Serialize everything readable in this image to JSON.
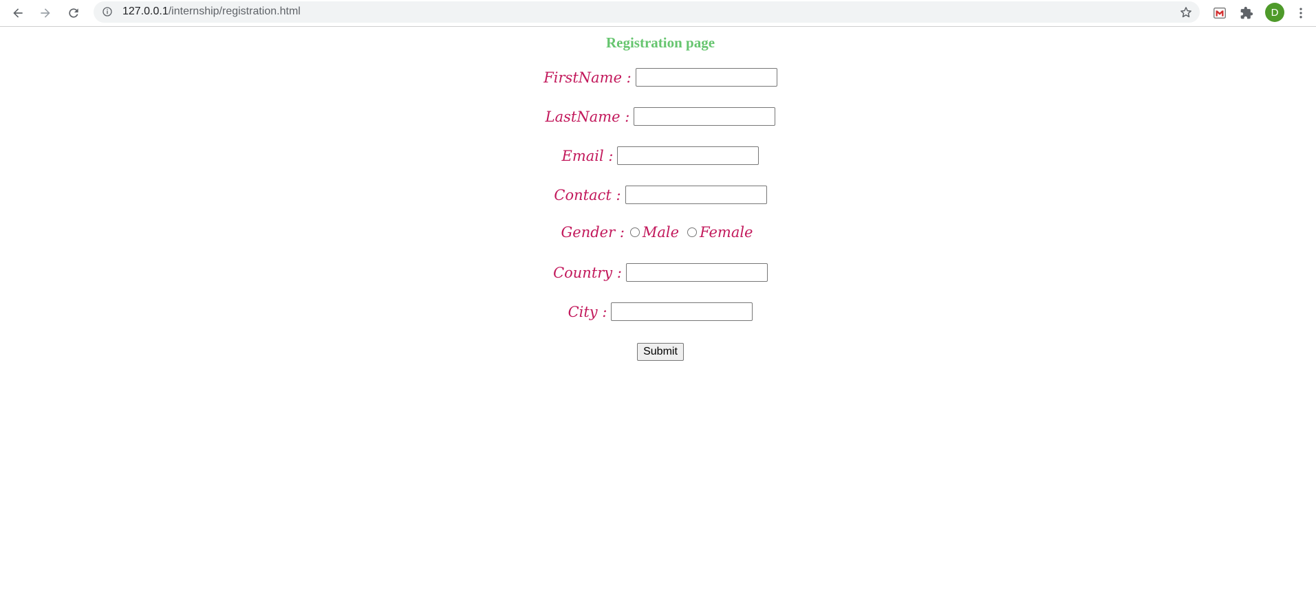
{
  "browser": {
    "url_host": "127.0.0.1",
    "url_path": "/internship/registration.html",
    "avatar_letter": "D",
    "icons": {
      "back": "arrow-left-icon",
      "forward": "arrow-right-icon",
      "reload": "reload-icon",
      "info": "info-icon",
      "bookmark": "star-icon",
      "extension1": "mail-extension-icon",
      "extensions": "puzzle-icon",
      "menu": "kebab-menu-icon"
    }
  },
  "page": {
    "title": "Registration page",
    "fields": {
      "firstname_label": "FirstName :",
      "lastname_label": "LastName :",
      "email_label": "Email :",
      "contact_label": "Contact :",
      "gender_label": "Gender :",
      "gender_options": [
        "Male",
        "Female"
      ],
      "country_label": "Country :",
      "city_label": "City :"
    },
    "values": {
      "firstname": "",
      "lastname": "",
      "email": "",
      "contact": "",
      "country": "",
      "city": ""
    },
    "submit_label": "Submit"
  },
  "colors": {
    "title": "#66c56f",
    "labels": "#c2185b",
    "avatar": "#4e9a2a"
  }
}
